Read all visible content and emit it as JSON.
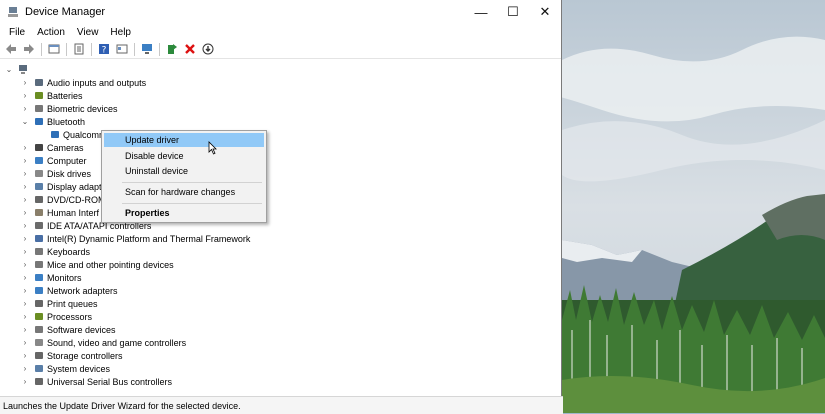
{
  "window": {
    "title": "Device Manager",
    "minimize": "—",
    "maximize": "☐",
    "close": "✕"
  },
  "menu": [
    "File",
    "Action",
    "View",
    "Help"
  ],
  "toolbar_icons": [
    "back-arrow-icon",
    "forward-arrow-icon",
    "show-hide-tree-icon",
    "properties-icon",
    "help-icon",
    "view-icon",
    "scan-hardware-icon",
    "update-driver-icon",
    "uninstall-icon",
    "download-icon"
  ],
  "tree": {
    "root": "",
    "items": [
      {
        "label": "Audio inputs and outputs",
        "icon": "speaker-icon",
        "expanded": false
      },
      {
        "label": "Batteries",
        "icon": "battery-icon",
        "expanded": false
      },
      {
        "label": "Biometric devices",
        "icon": "biometric-icon",
        "expanded": false
      },
      {
        "label": "Bluetooth",
        "icon": "bluetooth-icon",
        "expanded": true
      },
      {
        "label": "Qualcomm",
        "icon": "bluetooth-device-icon",
        "child": true
      },
      {
        "label": "Cameras",
        "icon": "camera-icon",
        "expanded": false
      },
      {
        "label": "Computer",
        "icon": "monitor-icon",
        "expanded": false
      },
      {
        "label": "Disk drives",
        "icon": "disk-icon",
        "expanded": false
      },
      {
        "label": "Display adapt",
        "icon": "display-icon",
        "expanded": false
      },
      {
        "label": "DVD/CD-ROM",
        "icon": "dvd-icon",
        "expanded": false
      },
      {
        "label": "Human Interf",
        "icon": "hid-icon",
        "expanded": false
      },
      {
        "label": "IDE ATA/ATAPI controllers",
        "icon": "ide-icon",
        "expanded": false
      },
      {
        "label": "Intel(R) Dynamic Platform and Thermal Framework",
        "icon": "chip-icon",
        "expanded": false
      },
      {
        "label": "Keyboards",
        "icon": "keyboard-icon",
        "expanded": false
      },
      {
        "label": "Mice and other pointing devices",
        "icon": "mouse-icon",
        "expanded": false
      },
      {
        "label": "Monitors",
        "icon": "monitor-icon",
        "expanded": false
      },
      {
        "label": "Network adapters",
        "icon": "network-icon",
        "expanded": false
      },
      {
        "label": "Print queues",
        "icon": "printer-icon",
        "expanded": false
      },
      {
        "label": "Processors",
        "icon": "processor-icon",
        "expanded": false
      },
      {
        "label": "Software devices",
        "icon": "software-icon",
        "expanded": false
      },
      {
        "label": "Sound, video and game controllers",
        "icon": "sound-icon",
        "expanded": false
      },
      {
        "label": "Storage controllers",
        "icon": "storage-icon",
        "expanded": false
      },
      {
        "label": "System devices",
        "icon": "system-icon",
        "expanded": false
      },
      {
        "label": "Universal Serial Bus controllers",
        "icon": "usb-icon",
        "expanded": false
      }
    ]
  },
  "context_menu": {
    "update_driver": "Update driver",
    "disable_device": "Disable device",
    "uninstall_device": "Uninstall device",
    "scan_hardware": "Scan for hardware changes",
    "properties": "Properties"
  },
  "status": "Launches the Update Driver Wizard for the selected device.",
  "colors": {
    "highlight": "#91c9f7",
    "icon_blue": "#2e6fb7"
  }
}
